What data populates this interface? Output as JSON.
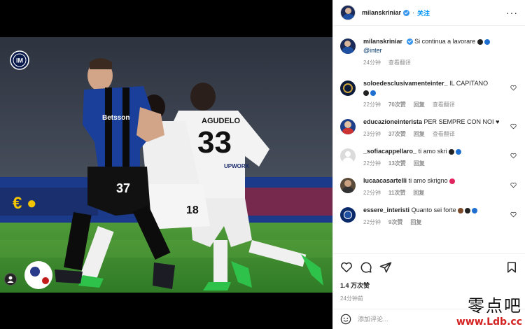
{
  "post": {
    "username": "milanskriniar",
    "follow_label": "关注",
    "caption_text": "Si continua a lavorare",
    "caption_mention": "@inter",
    "caption_time": "24分钟",
    "caption_translate": "查看翻译",
    "likes": "1.4 万次赞",
    "posted_time": "24分钟前",
    "comment_placeholder": "添加评论..."
  },
  "comments": [
    {
      "user": "soloedesclusivamenteinter_",
      "text": "IL CAPITANO",
      "time": "22分钟",
      "likes": "70次赞",
      "reply": "回复",
      "translate": "查看翻译",
      "avatar_color": "#0b1a3a"
    },
    {
      "user": "educazioneinterista",
      "text": "PER SEMPRE CON NOI ♥",
      "time": "23分钟",
      "likes": "37次赞",
      "reply": "回复",
      "translate": "查看翻译",
      "avatar_color": "#1d3f8a"
    },
    {
      "user": "_sofiacappellaro_",
      "text": "ti amo skri",
      "time": "22分钟",
      "likes": "13次赞",
      "reply": "回复",
      "translate": "",
      "avatar_color": "#dbdbdb"
    },
    {
      "user": "lucaacasartelli",
      "text": "ti amo skrigno",
      "time": "22分钟",
      "likes": "11次赞",
      "reply": "回复",
      "translate": "",
      "avatar_color": "#5a4a3a"
    },
    {
      "user": "essere_interisti",
      "text": "Quanto sei forte",
      "time": "22分钟",
      "likes": "9次赞",
      "reply": "回复",
      "translate": "",
      "avatar_color": "#0a2a6a"
    }
  ],
  "photo": {
    "player_front_number": "37",
    "opponent_number_left": "18",
    "opponent_number_right": "33",
    "opponent_name": "AGUDELO",
    "sponsor_text": "Betsson",
    "shirt_sponsor": "UPWORK"
  },
  "watermark": {
    "cn": "零点吧",
    "url": "www.Ldb.cc"
  },
  "colors": {
    "accent": "#0095f6",
    "verified": "#3897f0",
    "heart": "#ed4956",
    "pitch": "#3a8a2e",
    "inter_blue": "#1f4fa0"
  }
}
